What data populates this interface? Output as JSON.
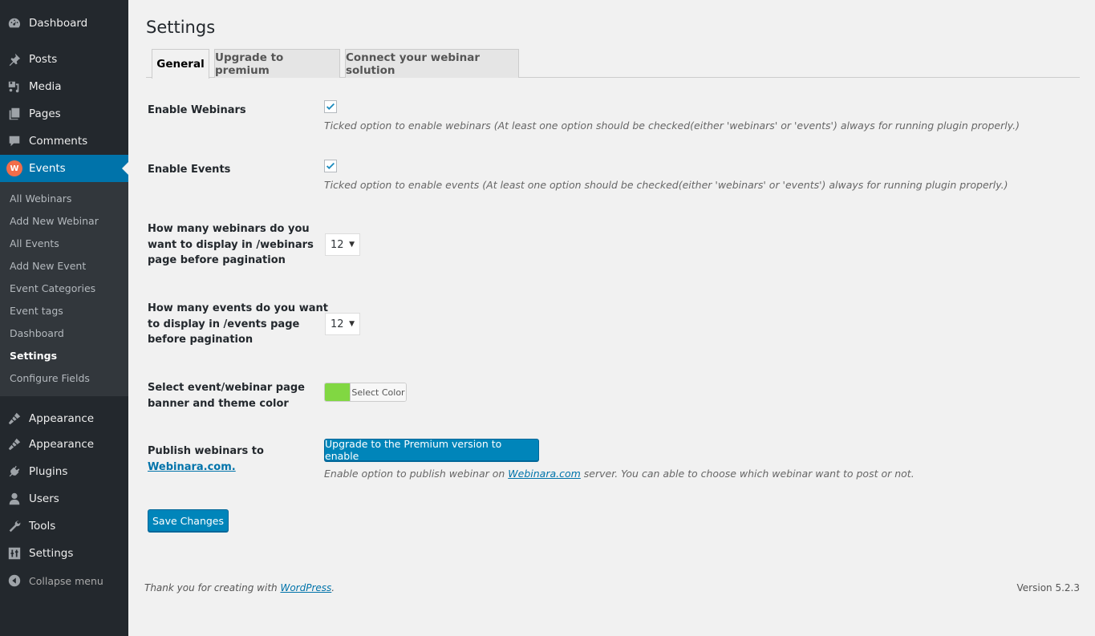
{
  "sidebar": {
    "items": [
      {
        "label": "Dashboard",
        "icon": "dashboard-icon"
      },
      {
        "label": "Posts",
        "icon": "pin-icon"
      },
      {
        "label": "Media",
        "icon": "media-icon"
      },
      {
        "label": "Pages",
        "icon": "pages-icon"
      },
      {
        "label": "Comments",
        "icon": "comment-icon"
      },
      {
        "label": "Events",
        "icon": "events-logo-icon",
        "current": true,
        "logo_letter": "W",
        "logo_color": "#f26d4a"
      },
      {
        "label": "Appearance",
        "icon": "paintbrush-icon"
      },
      {
        "label": "Appearance",
        "icon": "paintbrush-icon"
      },
      {
        "label": "Plugins",
        "icon": "plugin-icon"
      },
      {
        "label": "Users",
        "icon": "user-icon"
      },
      {
        "label": "Tools",
        "icon": "wrench-icon"
      },
      {
        "label": "Settings",
        "icon": "settings-sliders-icon"
      },
      {
        "label": "Collapse menu",
        "icon": "collapse-icon"
      }
    ],
    "submenu": [
      {
        "label": "All Webinars"
      },
      {
        "label": "Add New Webinar"
      },
      {
        "label": "All Events"
      },
      {
        "label": "Add New Event"
      },
      {
        "label": "Event Categories"
      },
      {
        "label": "Event tags"
      },
      {
        "label": "Dashboard"
      },
      {
        "label": "Settings",
        "current": true
      },
      {
        "label": "Configure Fields"
      }
    ]
  },
  "page": {
    "title": "Settings",
    "tabs": [
      {
        "label": "General",
        "active": true
      },
      {
        "label": "Upgrade to premium"
      },
      {
        "label": "Connect your webinar solution"
      }
    ]
  },
  "settings": {
    "enable_webinars": {
      "label": "Enable Webinars",
      "checked": true,
      "description": "Ticked option to enable webinars (At least one option should be checked(either 'webinars' or 'events') always for running plugin properly.)"
    },
    "enable_events": {
      "label": "Enable Events",
      "checked": true,
      "description": "Ticked option to enable events (At least one option should be checked(either 'webinars' or 'events') always for running plugin properly.)"
    },
    "webinars_per_page": {
      "label_lines": [
        "How many webinars do you",
        "want to display in /webinars",
        "page before pagination"
      ],
      "value": "12"
    },
    "events_per_page": {
      "label_lines": [
        "How many events do you want",
        "to display in /events page",
        "before pagination"
      ],
      "value": "12"
    },
    "theme_color": {
      "label_lines": [
        "Select event/webinar page",
        "banner and theme color"
      ],
      "button_label": "Select Color",
      "color": "#81d742"
    },
    "publish": {
      "label_line1": "Publish webinars to",
      "label_link": "Webinara.com.",
      "button_label": "Upgrade to the Premium version to enable",
      "description_before": "Enable option to publish webinar on ",
      "description_link": "Webinara.com",
      "description_after": " server. You can able to choose which webinar want to post or not."
    },
    "save_label": "Save Changes"
  },
  "footer": {
    "thanks_before": "Thank you for creating with ",
    "thanks_link": "WordPress",
    "thanks_after": ".",
    "version": "Version 5.2.3"
  },
  "colors": {
    "sidebar_bg": "#23282d",
    "submenu_bg": "#32373c",
    "accent": "#0073aa",
    "button_primary": "#0085ba"
  }
}
